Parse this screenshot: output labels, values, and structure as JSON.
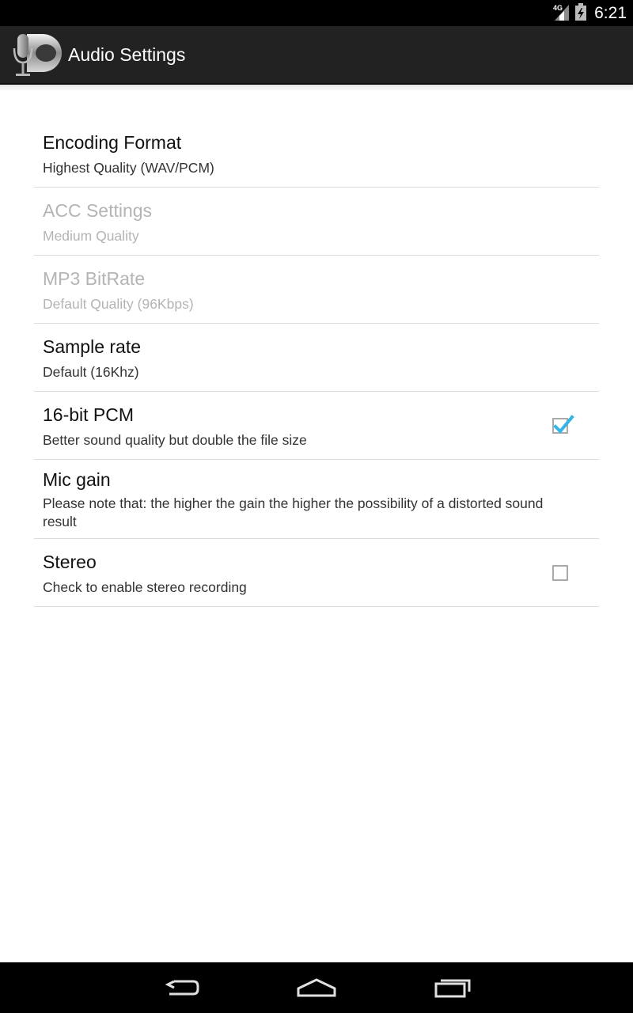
{
  "status_bar": {
    "network_label": "4G",
    "time": "6:21"
  },
  "action_bar": {
    "title": "Audio Settings",
    "logo_icon": "microphone-logo-icon"
  },
  "preferences": [
    {
      "title": "Encoding Format",
      "summary": "Highest Quality (WAV/PCM)",
      "enabled": true
    },
    {
      "title": "ACC Settings",
      "summary": "Medium Quality",
      "enabled": false
    },
    {
      "title": "MP3 BitRate",
      "summary": "Default Quality (96Kbps)",
      "enabled": false
    },
    {
      "title": "Sample rate",
      "summary": "Default (16Khz)",
      "enabled": true
    },
    {
      "title": "16-bit PCM",
      "summary": "Better sound quality but double the file size",
      "enabled": true,
      "checked": true
    },
    {
      "title": "Mic gain",
      "summary": "Please note that: the higher the gain the higher the possibility of a distorted sound result",
      "enabled": true
    },
    {
      "title": "Stereo",
      "summary": "Check to enable stereo recording",
      "enabled": true,
      "checked": false
    }
  ],
  "nav_bar": {
    "icons": [
      "back-icon",
      "home-icon",
      "recents-icon"
    ]
  },
  "colors": {
    "accent": "#33b5e5",
    "action_bar": "#222222",
    "disabled_text": "#b4b4b4"
  }
}
